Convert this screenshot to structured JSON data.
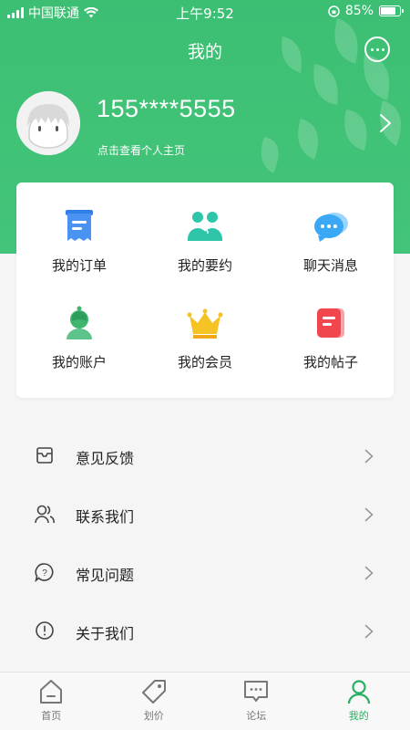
{
  "status_bar": {
    "carrier": "中国联通",
    "time": "上午9:52",
    "battery": "85%",
    "battery_level": 0.85
  },
  "header": {
    "title": "我的"
  },
  "profile": {
    "phone": "155****5555",
    "hint": "点击查看个人主页"
  },
  "grid": [
    {
      "label": "我的订单",
      "icon": "order-icon"
    },
    {
      "label": "我的要约",
      "icon": "appointment-icon"
    },
    {
      "label": "聊天消息",
      "icon": "chat-message-icon"
    },
    {
      "label": "我的账户",
      "icon": "account-icon"
    },
    {
      "label": "我的会员",
      "icon": "crown-icon"
    },
    {
      "label": "我的帖子",
      "icon": "post-icon"
    }
  ],
  "menu": [
    {
      "label": "意见反馈",
      "icon": "feedback-icon"
    },
    {
      "label": "联系我们",
      "icon": "contact-icon"
    },
    {
      "label": "常见问题",
      "icon": "faq-icon"
    },
    {
      "label": "关于我们",
      "icon": "about-icon"
    }
  ],
  "tabs": [
    {
      "label": "首页",
      "icon": "home-icon"
    },
    {
      "label": "划价",
      "icon": "price-tag-icon"
    },
    {
      "label": "论坛",
      "icon": "forum-icon"
    },
    {
      "label": "我的",
      "icon": "profile-icon",
      "active": true
    }
  ],
  "colors": {
    "brand_green": "#3cbf73",
    "active_tab": "#27ae60"
  }
}
